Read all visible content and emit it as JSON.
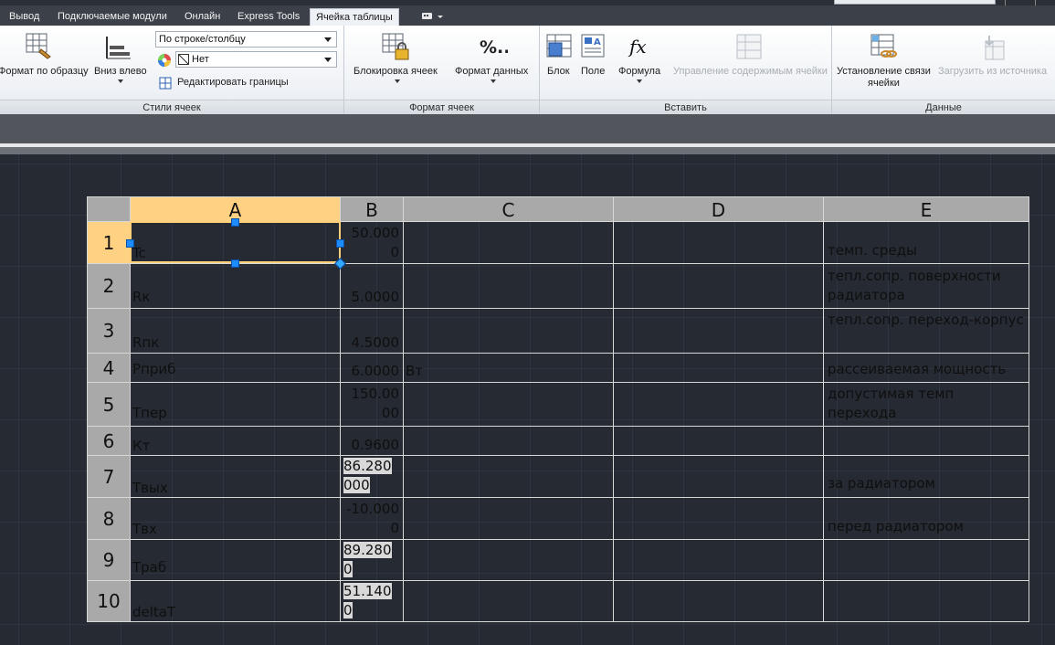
{
  "tabs": [
    {
      "label": "Вывод"
    },
    {
      "label": "Подключаемые модули"
    },
    {
      "label": "Онлайн"
    },
    {
      "label": "Express Tools"
    },
    {
      "label": "Ячейка таблицы",
      "active": true
    }
  ],
  "ribbon": {
    "cell_styles": {
      "title": "Стили ячеек",
      "format_painter": "Формат по образцу",
      "align": "Вниз влево",
      "row_col_combo": "По строке/столбцу",
      "fill_combo": "Нет",
      "edit_borders": "Редактировать границы"
    },
    "cell_format": {
      "title": "Формат ячеек",
      "lock_cells": "Блокировка ячеек",
      "data_format": "Формат данных"
    },
    "insert": {
      "title": "Вставить",
      "block": "Блок",
      "field": "Поле",
      "formula": "Формула",
      "manage_contents": "Управление содержимым ячейки"
    },
    "data": {
      "title": "Данные",
      "link_cell_1": "Установление связи",
      "link_cell_2": "ячейки",
      "download_source": "Загрузить из источника"
    }
  },
  "table": {
    "columns": [
      "A",
      "B",
      "C",
      "D",
      "E"
    ],
    "rows": [
      {
        "num": "1",
        "a": "Tc",
        "b": "50.0000",
        "b_hl": false,
        "c": "",
        "e": "темп. среды"
      },
      {
        "num": "2",
        "a": "Rк",
        "b": "5.0000",
        "b_hl": false,
        "c": "",
        "e": "тепл.сопр. поверхности радиатора"
      },
      {
        "num": "3",
        "a": "Rпк",
        "b": "4.5000",
        "b_hl": false,
        "c": "",
        "e": "тепл.сопр. переход-корпус"
      },
      {
        "num": "4",
        "a": "Рприб",
        "b": "6.0000",
        "b_hl": false,
        "c": "Вт",
        "e": "рассеиваемая мощность"
      },
      {
        "num": "5",
        "a": "Tпер",
        "b": "150.0000",
        "b_hl": false,
        "c": "",
        "e": "допустимая темп перехода"
      },
      {
        "num": "6",
        "a": "Кт",
        "b": "0.9600",
        "b_hl": false,
        "c": "",
        "e": ""
      },
      {
        "num": "7",
        "a": "Твых",
        "b": "86.280000",
        "b_hl": true,
        "c": "",
        "e": "за радиатором"
      },
      {
        "num": "8",
        "a": "Твх",
        "b": "-10.0000",
        "b_hl": false,
        "c": "",
        "e": "перед радиатором"
      },
      {
        "num": "9",
        "a": "Траб",
        "b": "89.2800",
        "b_hl": true,
        "c": "",
        "e": ""
      },
      {
        "num": "10",
        "a": "deltaT",
        "b": "51.1400",
        "b_hl": true,
        "c": "",
        "e": ""
      }
    ]
  },
  "colors": {
    "selection": "#ffd183",
    "header_gray": "#a9a9a9",
    "canvas": "#252a33",
    "grip": "#1d8cff"
  }
}
